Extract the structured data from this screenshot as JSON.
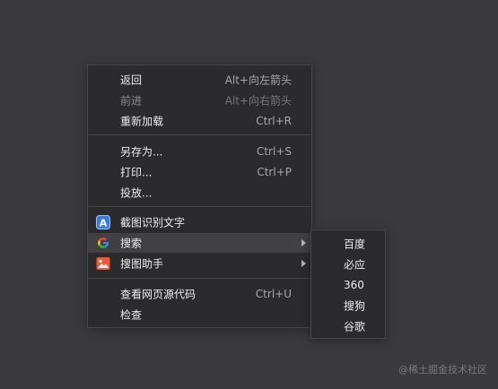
{
  "menu": {
    "items": [
      {
        "label": "返回",
        "shortcut": "Alt+向左箭头"
      },
      {
        "label": "前进",
        "shortcut": "Alt+向右箭头"
      },
      {
        "label": "重新加载",
        "shortcut": "Ctrl+R"
      },
      {
        "label": "另存为...",
        "shortcut": "Ctrl+S"
      },
      {
        "label": "打印...",
        "shortcut": "Ctrl+P"
      },
      {
        "label": "投放..."
      },
      {
        "label": "截图识别文字",
        "icon": "ocr-a-icon"
      },
      {
        "label": "搜索",
        "icon": "google-g-icon"
      },
      {
        "label": "搜图助手",
        "icon": "image-search-icon"
      },
      {
        "label": "查看网页源代码",
        "shortcut": "Ctrl+U"
      },
      {
        "label": "检查"
      }
    ]
  },
  "submenu": {
    "items": [
      {
        "label": "百度"
      },
      {
        "label": "必应"
      },
      {
        "label": "360"
      },
      {
        "label": "搜狗"
      },
      {
        "label": "谷歌"
      }
    ]
  },
  "watermark": "@稀土掘金技术社区",
  "colors": {
    "background": "#3a3a3d",
    "menu_bg": "#2b2b2d",
    "hover_bg": "#414145",
    "text": "#ececec",
    "disabled_text": "#8a8a8e"
  }
}
